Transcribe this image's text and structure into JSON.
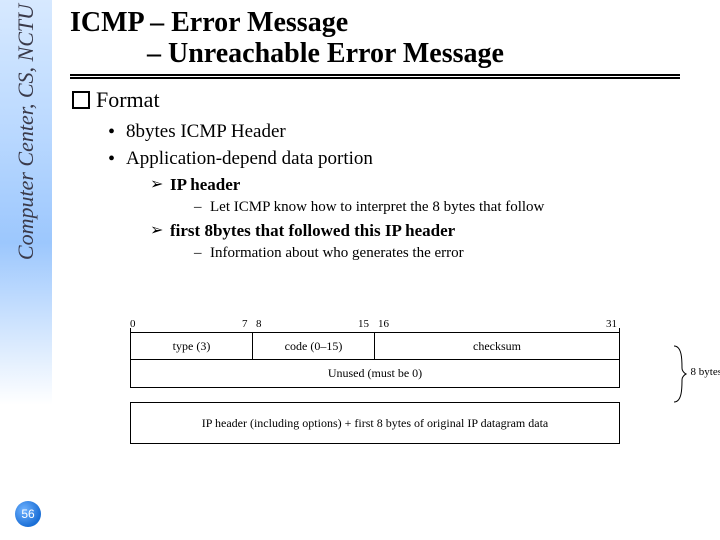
{
  "sidebar": {
    "text": "Computer Center, CS, NCTU"
  },
  "page_number": "56",
  "title": {
    "line1": "ICMP – Error Message",
    "line2": "           – Unreachable Error Message"
  },
  "section": {
    "format_label": "Format",
    "bullets": [
      "8bytes ICMP Header",
      "Application-depend data portion"
    ],
    "sub": [
      {
        "label": "IP header",
        "detail": "Let ICMP know how to interpret the 8 bytes that follow"
      },
      {
        "label": "first 8bytes that followed this IP header",
        "detail": "Information about who generates the error"
      }
    ]
  },
  "diagram": {
    "ticks": {
      "t0": "0",
      "t7": "7",
      "t8": "8",
      "t15": "15",
      "t16": "16",
      "t31": "31"
    },
    "row1": {
      "type": "type (3)",
      "code": "code (0–15)",
      "checksum": "checksum"
    },
    "row2": "Unused (must be 0)",
    "row3": "IP header (including options) + first 8 bytes of original IP datagram data",
    "brace_label": "8 bytes"
  }
}
